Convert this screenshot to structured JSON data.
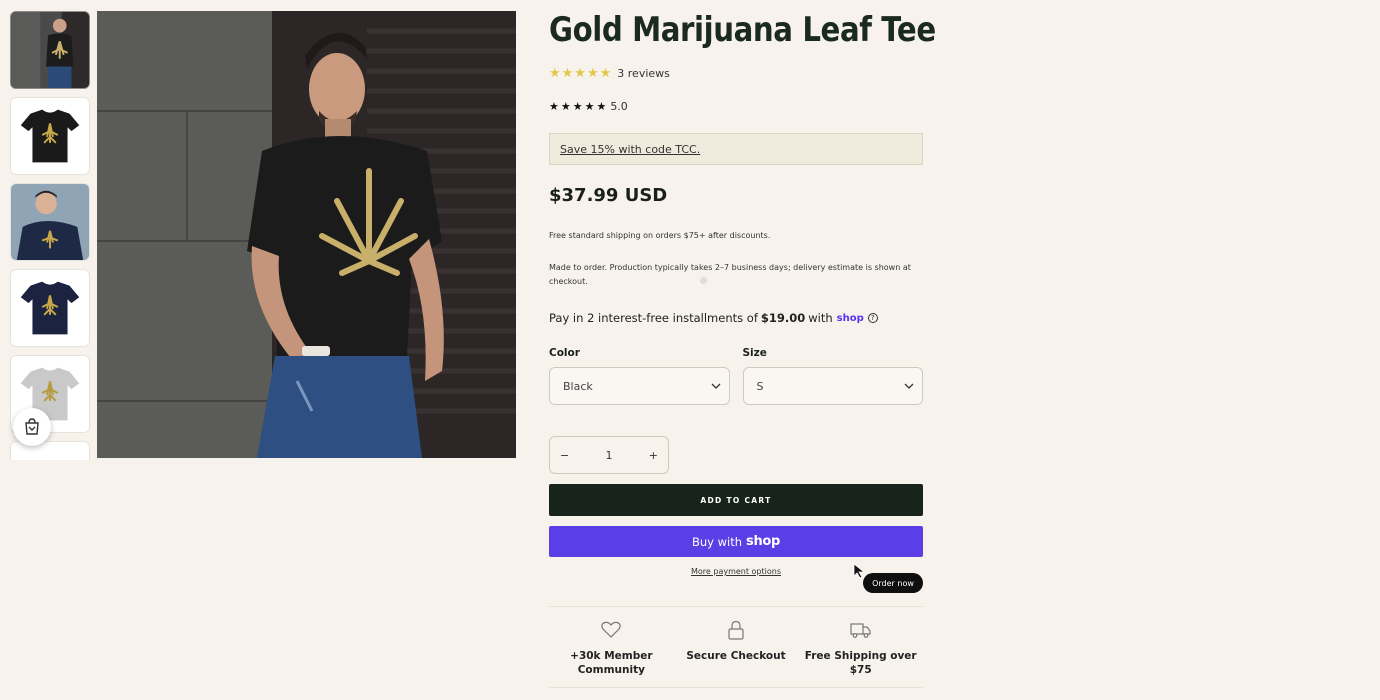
{
  "product": {
    "title": "Gold Marijuana Leaf Tee",
    "reviews_text": "3 reviews",
    "rating_score": "5.0",
    "rating_value": 5,
    "promo_text": "Save 15% with code TCC.",
    "price": "$37.99 USD",
    "shipping_note": "Free standard shipping on orders $75+ after discounts.",
    "production_note": "Made to order. Production typically takes 2–7 business days; delivery estimate is shown at checkout."
  },
  "installments": {
    "prefix": "Pay in 2 interest-free installments of",
    "amount": "$19.00",
    "with": "with",
    "brand": "shop",
    "help": "?"
  },
  "options": {
    "color_label": "Color",
    "color_value": "Black",
    "size_label": "Size",
    "size_value": "S"
  },
  "quantity": {
    "minus": "−",
    "value": "1",
    "plus": "+"
  },
  "buttons": {
    "add_to_cart": "ADD TO CART",
    "buy_with": "Buy with",
    "buy_brand": "shop",
    "more_payment": "More payment options",
    "order_now": "Order now"
  },
  "features": [
    {
      "icon": "heart-icon",
      "text": "+30k Member Community"
    },
    {
      "icon": "lock-icon",
      "text": "Secure Checkout"
    },
    {
      "icon": "truck-icon",
      "text": "Free Shipping over $75"
    }
  ],
  "colors": {
    "background": "#f7f3ec",
    "add_to_cart_bg": "#17231b",
    "shop_purple": "#5a3ee6",
    "star_gold": "#e2c84a"
  }
}
